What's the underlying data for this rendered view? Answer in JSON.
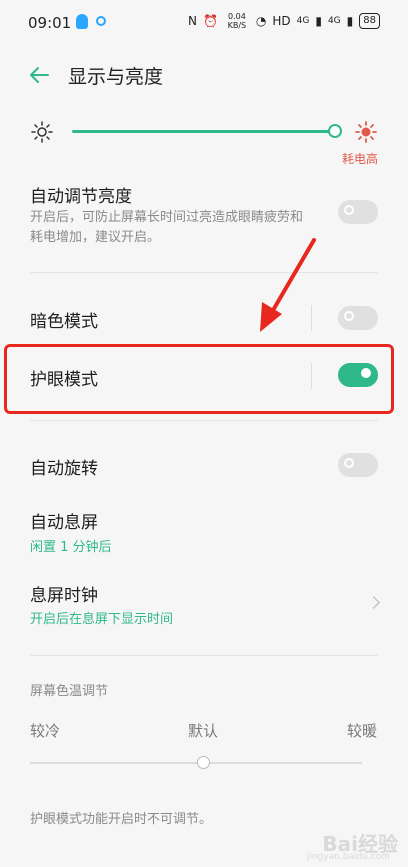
{
  "status_bar": {
    "time": "09:01",
    "net_speed": "0.04 KB/S",
    "network": "HD",
    "signal_1": "4G",
    "signal_2": "4G",
    "battery": "88"
  },
  "header": {
    "title": "显示与亮度"
  },
  "brightness": {
    "level_fraction": 0.99,
    "power_label": "耗电高"
  },
  "settings": {
    "auto_brightness": {
      "title": "自动调节亮度",
      "desc_line1": "开启后，可防止屏幕长时间过亮造成眼睛疲劳和",
      "desc_line2": "耗电增加，建议开启。",
      "enabled": false
    },
    "dark_mode": {
      "title": "暗色模式",
      "enabled": false
    },
    "eye_care": {
      "title": "护眼模式",
      "enabled": true
    },
    "auto_rotate": {
      "title": "自动旋转",
      "enabled": false
    },
    "auto_screen_off": {
      "title": "自动息屏",
      "value": "闲置 1 分钟后"
    },
    "screen_off_clock": {
      "title": "息屏时钟",
      "value": "开启后在息屏下显示时间"
    }
  },
  "color_temperature": {
    "section_title": "屏幕色温调节",
    "cold_label": "较冷",
    "default_label": "默认",
    "warm_label": "较暖",
    "level_fraction": 0.5,
    "note": "护眼模式功能开启时不可调节。"
  },
  "watermark": {
    "text": "Bai经验",
    "sub": "jingyan.baidu.com"
  },
  "colors": {
    "accent": "#2fb889",
    "highlight": "#e8281e",
    "warning": "#e25a4a"
  }
}
